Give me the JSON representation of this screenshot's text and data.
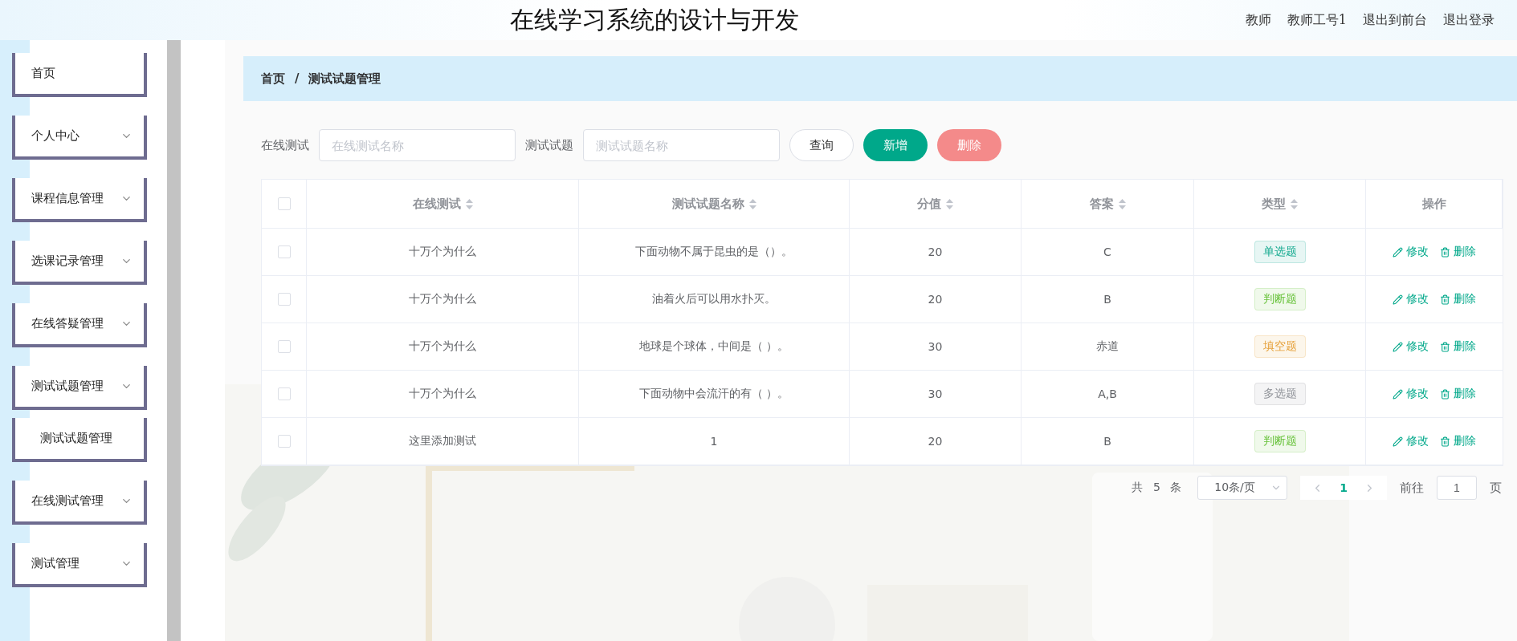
{
  "header": {
    "title": "在线学习系统的设计与开发",
    "user": [
      "教师",
      "教师工号1"
    ],
    "links": [
      "退出到前台",
      "退出登录"
    ]
  },
  "sidebar": {
    "items": [
      {
        "label": "首页",
        "kind": "link"
      },
      {
        "label": "个人中心",
        "kind": "menu"
      },
      {
        "label": "课程信息管理",
        "kind": "menu"
      },
      {
        "label": "选课记录管理",
        "kind": "menu"
      },
      {
        "label": "在线答疑管理",
        "kind": "menu"
      },
      {
        "label": "测试试题管理",
        "kind": "menu",
        "children": [
          {
            "label": "测试试题管理"
          }
        ]
      },
      {
        "label": "在线测试管理",
        "kind": "menu"
      },
      {
        "label": "测试管理",
        "kind": "menu"
      }
    ]
  },
  "breadcrumb": [
    "首页",
    "/",
    "测试试题管理"
  ],
  "filters": [
    {
      "label": "在线测试",
      "placeholder": "在线测试名称"
    },
    {
      "label": "测试试题",
      "placeholder": "测试试题名称"
    }
  ],
  "buttons": [
    {
      "label": "查询",
      "kind": "plain",
      "disabled": false
    },
    {
      "label": "新增",
      "kind": "primary",
      "disabled": false
    },
    {
      "label": "删除",
      "kind": "danger",
      "disabled": true
    }
  ],
  "table": {
    "all_checked": false,
    "columns": [
      {
        "label": "在线测试",
        "kind": "sortable"
      },
      {
        "label": "测试试题名称",
        "kind": "sortable"
      },
      {
        "label": "分值",
        "kind": "sortable"
      },
      {
        "label": "答案",
        "kind": "sortable"
      },
      {
        "label": "类型",
        "kind": "sortable"
      },
      {
        "label": "操作",
        "kind": "plain"
      }
    ],
    "rows": [
      {
        "checked": false,
        "test": "十万个为什么",
        "question": "下面动物不属于昆虫的是（）。",
        "score": "20",
        "answer": "C",
        "type": {
          "label": "单选题",
          "color": "#13a98f"
        },
        "actions": [
          "修改",
          "删除"
        ]
      },
      {
        "checked": false,
        "test": "十万个为什么",
        "question": "油着火后可以用水扑灭。",
        "score": "20",
        "answer": "B",
        "type": {
          "label": "判断题",
          "color": "#67c23a"
        },
        "actions": [
          "修改",
          "删除"
        ]
      },
      {
        "checked": false,
        "test": "十万个为什么",
        "question": "地球是个球体，中间是（ ）。",
        "score": "30",
        "answer": "赤道",
        "type": {
          "label": "填空题",
          "color": "#e6a23c"
        },
        "actions": [
          "修改",
          "删除"
        ]
      },
      {
        "checked": false,
        "test": "十万个为什么",
        "question": "下面动物中会流汗的有（ ）。",
        "score": "30",
        "answer": "A,B",
        "type": {
          "label": "多选题",
          "color": "#909399"
        },
        "actions": [
          "修改",
          "删除"
        ]
      },
      {
        "checked": false,
        "test": "这里添加测试",
        "question": "1",
        "score": "20",
        "answer": "B",
        "type": {
          "label": "判断题",
          "color": "#67c23a"
        },
        "actions": [
          "修改",
          "删除"
        ]
      }
    ]
  },
  "pagination": {
    "total": [
      "共",
      "5",
      "条"
    ],
    "page_size": "10条/页",
    "pages": [
      {
        "label": "1",
        "selected": true
      }
    ],
    "goto_label": "前往",
    "goto_value": "1",
    "goto_suffix": "页"
  }
}
